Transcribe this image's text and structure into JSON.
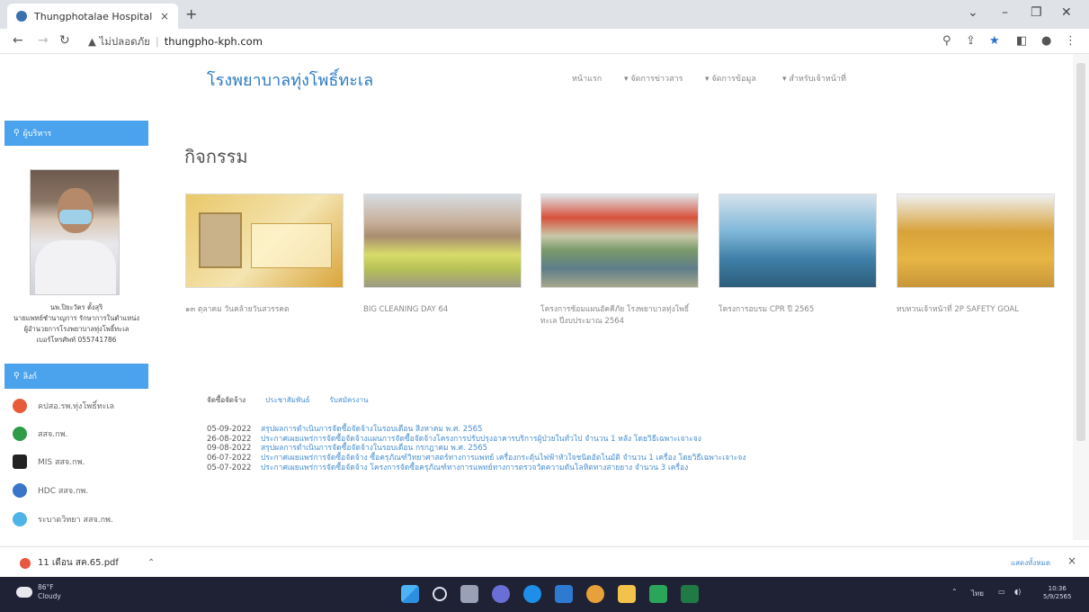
{
  "browser": {
    "tab_title": "Thungphotalae Hospital",
    "tab_close": "×",
    "new_tab": "+",
    "url_warning": "▲ ไม่ปลอดภัย",
    "url_host": "thungpho-kph.com"
  },
  "site": {
    "title": "โรงพยาบาลทุ่งโพธิ์ทะเล",
    "nav": [
      "หน้าแรก",
      "▾ จัดการข่าวสาร",
      "▾ จัดการข้อมูล",
      "▾ สำหรับเจ้าหน้าที่"
    ]
  },
  "sidebar": {
    "director_header": "ผู้บริหาร",
    "director_lines": [
      "นพ.ปิยะวัตร ตั้งสุริ",
      "นายแพทย์ชำนาญการ รักษาการในตำแหน่ง",
      "ผู้อำนวยการโรงพยาบาลทุ่งโพธิ์ทะเล",
      "เบอร์โทรศัพท์ 055741786"
    ],
    "links_header": "ลิงก์",
    "links": [
      {
        "label": "คปสอ.รพ.ทุ่งโพธิ์ทะเล",
        "color": "#e85a3a"
      },
      {
        "label": "สสจ.กพ.",
        "color": "#2e9b47"
      },
      {
        "label": "MIS สสจ.กพ.",
        "color": "#222222"
      },
      {
        "label": "HDC สสจ.กพ.",
        "color": "#3b74c9"
      },
      {
        "label": "ระบาดวิทยา สสจ.กพ.",
        "color": "#4fb3e8"
      }
    ]
  },
  "main": {
    "page_title": "กิจกรรม",
    "activities": [
      {
        "caption": "๑๓ ตุลาคม วันคล้ายวันสวรรคต"
      },
      {
        "caption": "BIG CLEANING DAY 64"
      },
      {
        "caption": "โครงการซ้อมแผนอัคคีภัย โรงพยาบาลทุ่งโพธิ์ทะเล ปีงบประมาณ 2564"
      },
      {
        "caption": "โครงการอบรม CPR ปี 2565"
      },
      {
        "caption": "ทบทวนเจ้าหน้าที่ 2P SAFETY GOAL"
      }
    ],
    "post_tabs": [
      "จัดซื้อจัดจ้าง",
      "ประชาสัมพันธ์",
      "รับสมัครงาน"
    ],
    "posts": [
      {
        "date": "05-09-2022",
        "title": "สรุปผลการดำเนินการจัดซื้อจัดจ้างในรอบเดือน สิงหาคม พ.ศ. 2565"
      },
      {
        "date": "26-08-2022",
        "title": "ประกาศเผยแพร่การจัดซื้อจัดจ้างแผนการจัดซื้อจัดจ้างโครงการปรับปรุงอาคารบริการผู้ป่วยในทั่วไป จำนวน 1 หลัง โดยวิธีเฉพาะเจาะจง"
      },
      {
        "date": "09-08-2022",
        "title": "สรุปผลการดำเนินการจัดซื้อจัดจ้างในรอบเดือน กรกฎาคม พ.ศ. 2565"
      },
      {
        "date": "06-07-2022",
        "title": "ประกาศเผยแพร่การจัดซื้อจัดจ้าง ซื้อครุภัณฑ์วิทยาศาสตร์ทางการแพทย์ เครื่องกระตุ้นไฟฟ้าหัวใจชนิดอัตโนมัติ จำนวน 1 เครื่อง โดยวิธีเฉพาะเจาะจง"
      },
      {
        "date": "05-07-2022",
        "title": "ประกาศเผยแพร่การจัดซื้อจัดจ้าง โครงการจัดซื้อครุภัณฑ์ทางการแพทย์ทางการตรวจวัดความดันโลหิตทางสายยาง จำนวน 3 เครื่อง"
      }
    ]
  },
  "download": {
    "file": "11 เดือน สค.65.pdf",
    "show_all": "แสดงทั้งหมด",
    "close": "×"
  },
  "taskbar": {
    "weather_temp": "86°F",
    "weather_desc": "Cloudy",
    "lang": "ไทย",
    "time": "10:36",
    "date": "5/9/2565"
  }
}
